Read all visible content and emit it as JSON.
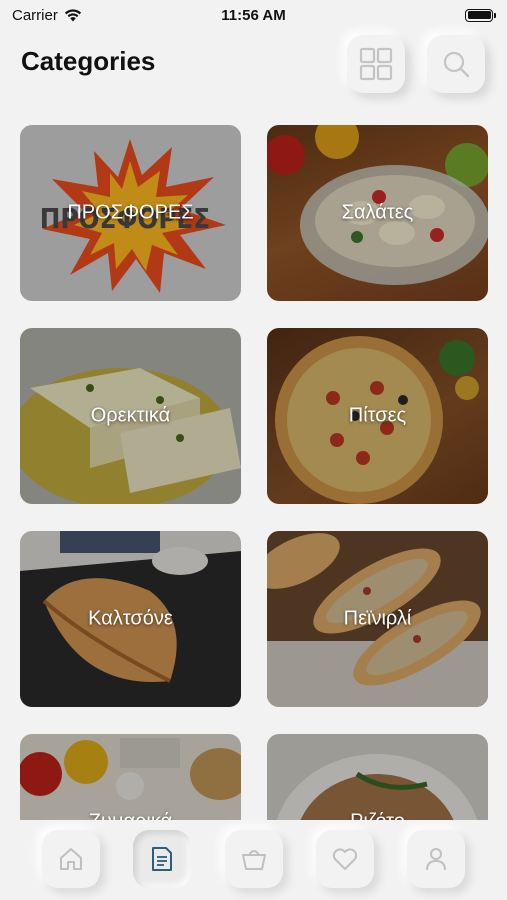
{
  "status_bar": {
    "carrier": "Carrier",
    "time": "11:56 AM",
    "battery_level": 1.0
  },
  "header": {
    "title": "Categories",
    "grid_icon": "grid-icon",
    "search_icon": "search-icon"
  },
  "categories": [
    {
      "label": "ΠΡΟΣΦΟΡΕΣ",
      "image_text": "ΠΡΟΣΦΟΡΕΣ"
    },
    {
      "label": "Σαλάτες"
    },
    {
      "label": "Ορεκτικά"
    },
    {
      "label": "Πίτσες"
    },
    {
      "label": "Καλτσόνε"
    },
    {
      "label": "Πεϊνιρλί"
    },
    {
      "label": "Ζυμαρικά"
    },
    {
      "label": "Ριζότο"
    }
  ],
  "tab_bar": {
    "tabs": [
      {
        "icon": "home-icon",
        "active": false
      },
      {
        "icon": "document-icon",
        "active": true
      },
      {
        "icon": "basket-icon",
        "active": false
      },
      {
        "icon": "heart-icon",
        "active": false
      },
      {
        "icon": "profile-icon",
        "active": false
      }
    ]
  },
  "colors": {
    "background": "#f2f2f2",
    "title": "#111111",
    "icon_gray": "#bfbfbf",
    "active_icon": "#2d5f7a"
  }
}
